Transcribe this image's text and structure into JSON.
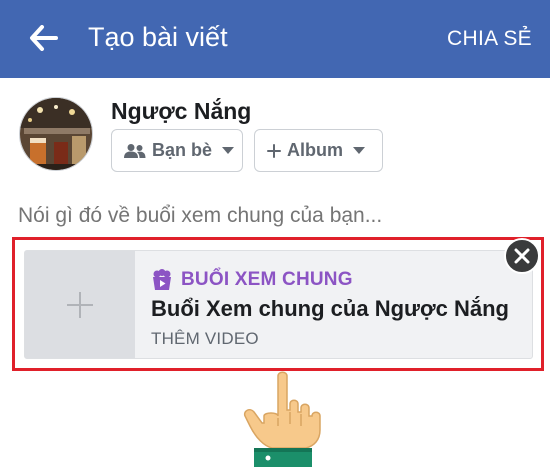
{
  "topbar": {
    "title": "Tạo bài viết",
    "share_label": "CHIA SẺ",
    "back_icon": "arrow-left-icon",
    "color": "#4267b2"
  },
  "user": {
    "name": "Ngược Nắng",
    "avatar_icon": "profile-photo"
  },
  "audience": {
    "label": "Bạn bè",
    "icon": "friends-icon"
  },
  "album": {
    "label": "Album",
    "icon": "plus-icon"
  },
  "composer": {
    "placeholder": "Nói gì đó về buổi xem chung của bạn..."
  },
  "watch_party": {
    "label": "BUỔI XEM CHUNG",
    "title": "Buổi Xem chung của Ngược Nắng",
    "subtitle": "THÊM VIDEO",
    "label_icon": "watch-party-icon",
    "accent_color": "#8c54c4"
  },
  "annotation": {
    "highlight_color": "#e0202a",
    "pointer_icon": "pointing-hand-icon"
  }
}
